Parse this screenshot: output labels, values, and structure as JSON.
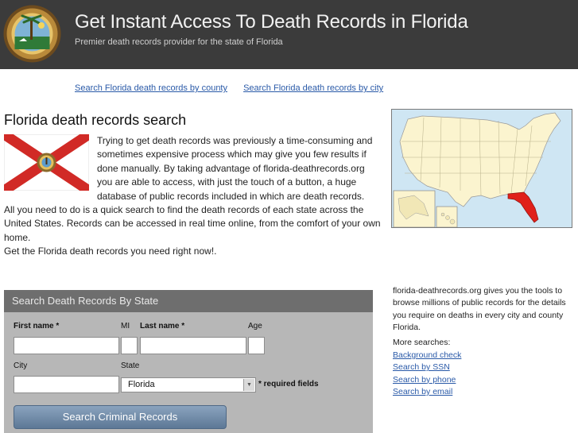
{
  "header": {
    "title": "Get Instant Access To Death Records in Florida",
    "subtitle": "Premier death records provider for the state of Florida"
  },
  "top_links": [
    "Search Florida death records by county",
    "Search Florida death records by city"
  ],
  "main": {
    "title": "Florida death records search",
    "intro_p1": "Trying to get death records was previously a time-consuming and sometimes expensive process which may give you few results if done manually. By taking advantage of florida-deathrecords.org you are able to access, with just the touch of a button, a huge database of public records included in which are death records.",
    "intro_p2": "All you need to do is a quick search to find the death records of each state across the United States. Records can be accessed in real time online, from the comfort of your own home.",
    "intro_p3": "Get the Florida death records you need right now!."
  },
  "form": {
    "heading": "Search Death Records By State",
    "first_name_label": "First name *",
    "mi_label": "MI",
    "last_name_label": "Last name *",
    "age_label": "Age",
    "city_label": "City",
    "state_label": "State",
    "state_value": "Florida",
    "required_note": "* required fields",
    "submit_label": "Search Criminal Records"
  },
  "sidebar": {
    "description": "florida-deathrecords.org gives you the tools to browse millions of public records for the details you require on deaths in every city and county Florida.",
    "more_searches_label": "More searches:",
    "links": [
      "Background check",
      "Search by SSN",
      "Search by phone",
      "Search by email"
    ]
  },
  "colors": {
    "header_bg": "#3b3b3b",
    "link": "#2a5aa8",
    "florida_highlight": "#e0201a",
    "form_bg": "#b7b7b7"
  }
}
